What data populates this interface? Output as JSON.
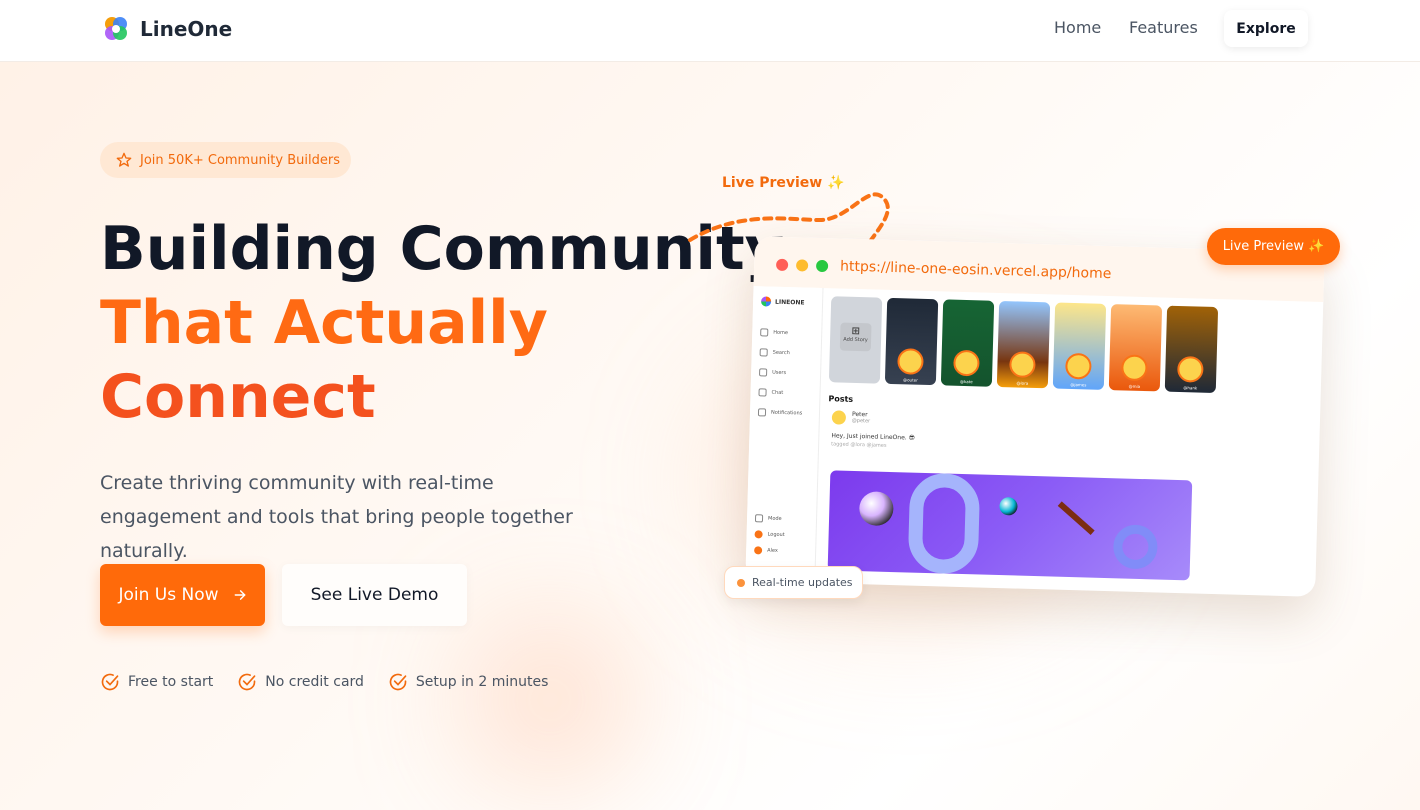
{
  "nav": {
    "brand": "LineOne",
    "links": [
      "Home",
      "Features"
    ],
    "explore": "Explore"
  },
  "hero": {
    "badge": "Join 50K+ Community Builders",
    "title_line1": "Building Community",
    "title_line2": "That Actually",
    "title_line3": "Connect",
    "description": "Create thriving community with real-time engagement and tools that bring people together naturally.",
    "primary_button": "Join Us Now",
    "secondary_button": "See Live Demo",
    "perks": [
      "Free to start",
      "No credit card",
      "Setup in 2 minutes"
    ]
  },
  "preview": {
    "label": "Live Preview ✨",
    "pill": "Live Preview ✨",
    "realtime": "Real-time updates",
    "url": "https://line-one-eosin.vercel.app/home",
    "app": {
      "logo": "LINEONE",
      "sidebar": [
        "Home",
        "Search",
        "Users",
        "Chat",
        "Notifications"
      ],
      "sidebar_bottom": [
        "Mode",
        "Logout",
        "Alex"
      ],
      "add_story": "Add Story",
      "stories": [
        "@outer",
        "@kate",
        "@lora",
        "@james",
        "@mia",
        "@hank"
      ],
      "posts_heading": "Posts",
      "post_user": "Peter",
      "post_handle": "@peter",
      "post_text": "Hey, Just joined LineOne. 😎",
      "post_tags": "tagged @lora @james"
    }
  },
  "colors": {
    "accent": "#ff6a0a",
    "title_dark": "#111827",
    "title_orange": "#ff6a13"
  }
}
